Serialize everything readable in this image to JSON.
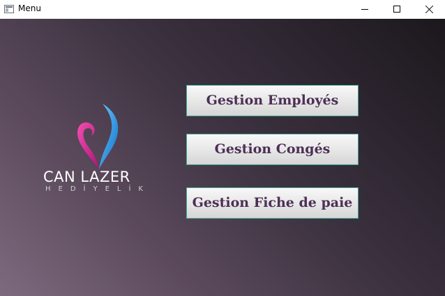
{
  "window": {
    "title": "Menu",
    "icons": {
      "app": "app-window-icon",
      "minimize": "minimize-icon",
      "maximize": "maximize-icon",
      "close": "close-icon"
    }
  },
  "logo": {
    "name": "CAN LAZER",
    "subtitle": "HEDİYELİK",
    "icon": "heart-pin-icon",
    "colors": {
      "pink": "#e8259a",
      "blue": "#1e8fe0"
    }
  },
  "menu": {
    "buttons": [
      {
        "label": "Gestion Employés"
      },
      {
        "label": "Gestion Congés"
      },
      {
        "label": "Gestion Fiche de paie"
      }
    ]
  },
  "colors": {
    "button_text": "#4d2f55",
    "button_border": "#3fa99a",
    "background_light": "#7d6a7e",
    "background_dark": "#1c171d"
  }
}
